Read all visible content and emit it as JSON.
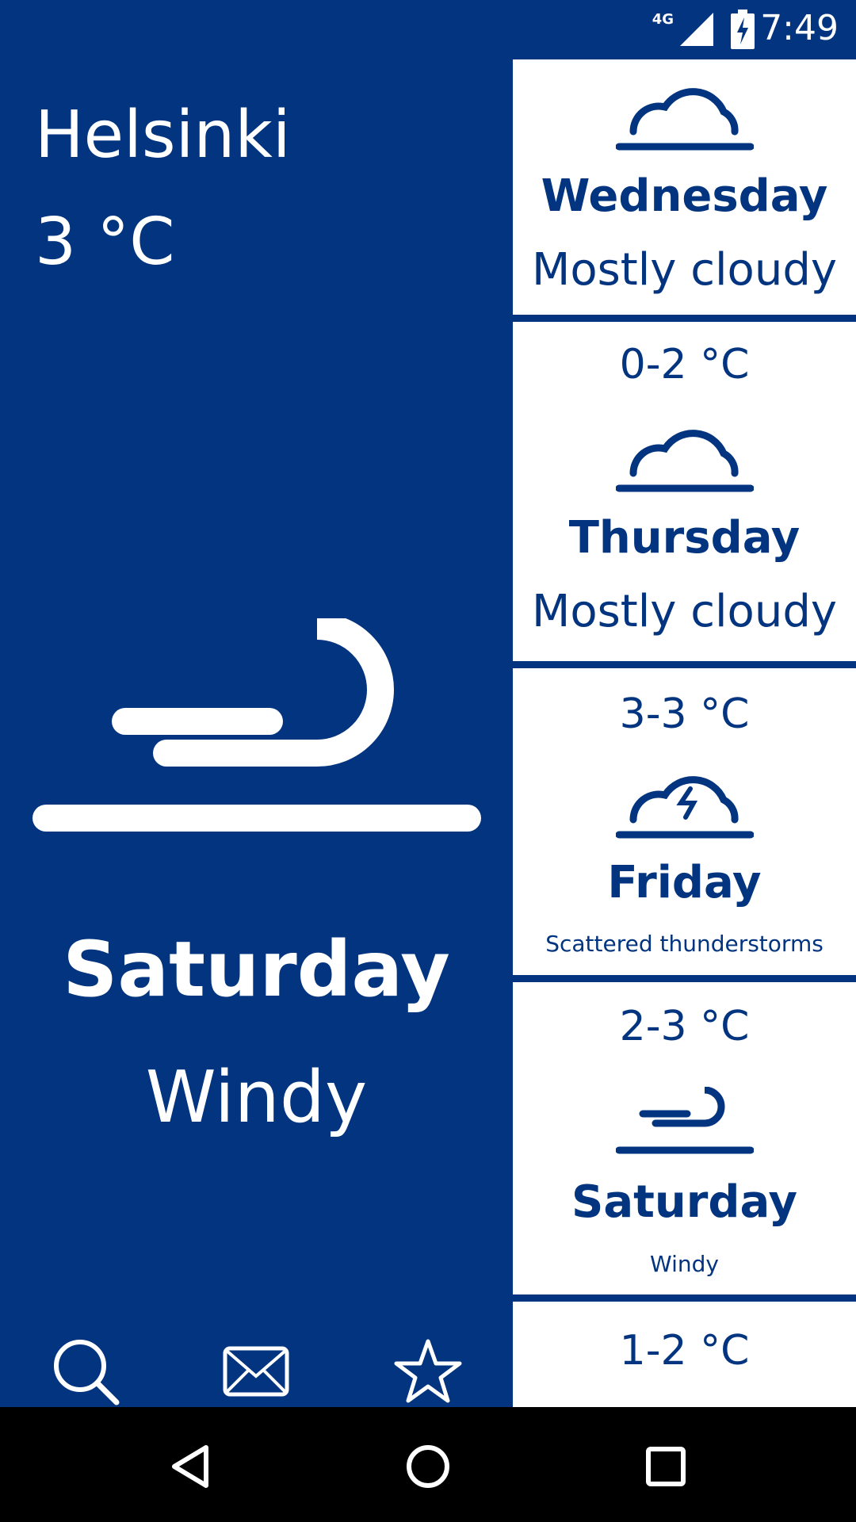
{
  "status_bar": {
    "network": "4G",
    "time": "7:49"
  },
  "location": {
    "city": "Helsinki",
    "current_temp": "3 °C"
  },
  "selected": {
    "day": "Saturday",
    "condition": "Windy",
    "icon": "wind-icon"
  },
  "toolbar": {
    "icons": [
      "search-icon",
      "mail-icon",
      "star-icon"
    ]
  },
  "forecast": [
    {
      "temp": "",
      "icon": "cloud-icon",
      "day": "Wednesday",
      "condition": "Mostly cloudy"
    },
    {
      "temp": "0-2 °C",
      "icon": "cloud-icon",
      "day": "Thursday",
      "condition": "Mostly cloudy"
    },
    {
      "temp": "3-3 °C",
      "icon": "thunderstorm-icon",
      "day": "Friday",
      "condition": "Scattered thunderstorms"
    },
    {
      "temp": "2-3 °C",
      "icon": "wind-icon",
      "day": "Saturday",
      "condition": "Windy"
    },
    {
      "temp": "1-2 °C",
      "icon": "",
      "day": "",
      "condition": ""
    }
  ],
  "colors": {
    "primary": "#02347f",
    "surface": "#ffffff",
    "nav": "#000000"
  }
}
